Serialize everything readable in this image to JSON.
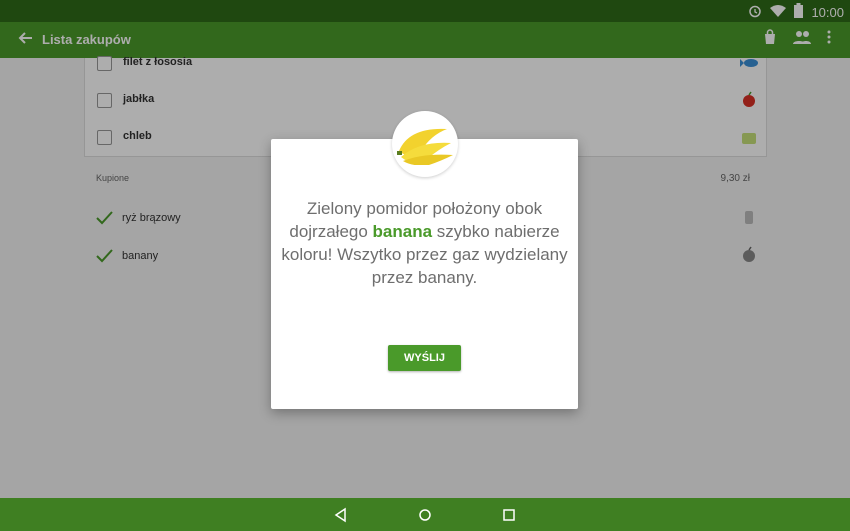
{
  "status_bar": {
    "time": "10:00"
  },
  "app_bar": {
    "title": "Lista zakupów"
  },
  "shopping_list": {
    "items": [
      {
        "label": "filet z łososia",
        "icon": "fish-icon"
      },
      {
        "label": "jabłka",
        "icon": "apple-icon"
      },
      {
        "label": "chleb",
        "icon": "bread-icon"
      }
    ]
  },
  "bought": {
    "header": "Kupione",
    "total": "9,30 zł",
    "items": [
      {
        "label": "ryż brązowy",
        "icon": "rice-icon"
      },
      {
        "label": "banany",
        "icon": "apple-icon"
      }
    ]
  },
  "dialog": {
    "text_before": "Zielony pomidor położony obok dojrzałego ",
    "highlight": "banana",
    "text_after": " szybko nabierze koloru! Wszytko przez gaz wydzielany przez banany.",
    "button_label": "WYŚLIJ",
    "image_icon": "bananas-icon"
  },
  "colors": {
    "status_bar": "#2f6b19",
    "app_bar": "#4a9a2a",
    "accent": "#4a9a2a",
    "nav_bar": "#3f7f22"
  }
}
